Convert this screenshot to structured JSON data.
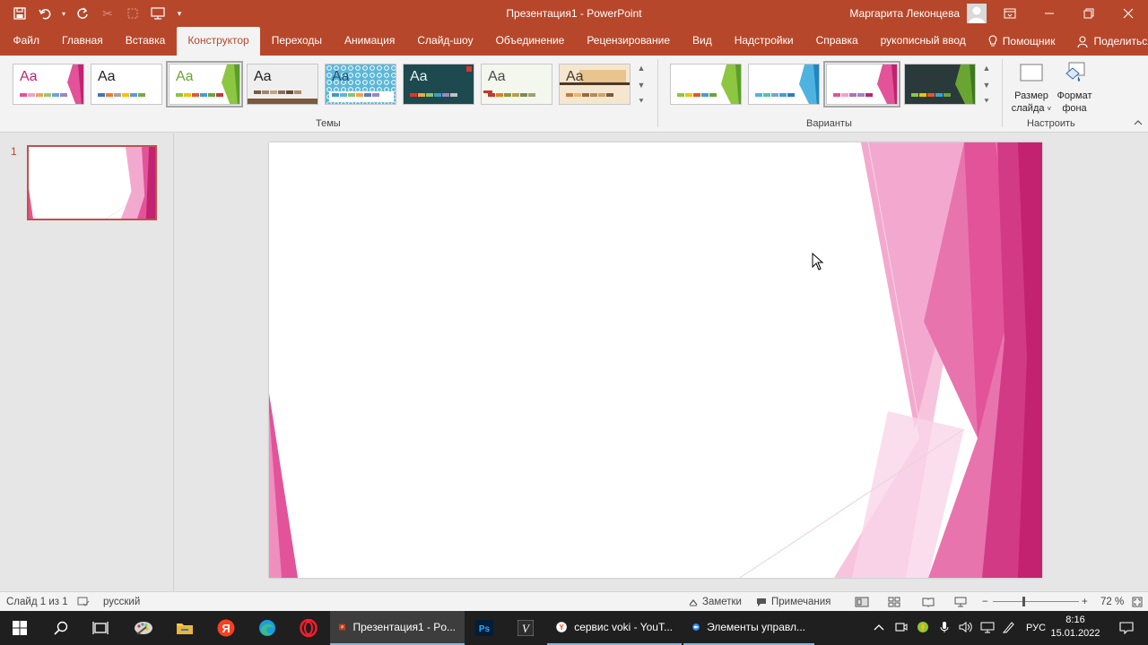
{
  "window": {
    "title": "Презентация1  -  PowerPoint",
    "user_name": "Маргарита Леконцева"
  },
  "tabs": [
    {
      "label": "Файл"
    },
    {
      "label": "Главная"
    },
    {
      "label": "Вставка"
    },
    {
      "label": "Конструктор",
      "active": true
    },
    {
      "label": "Переходы"
    },
    {
      "label": "Анимация"
    },
    {
      "label": "Слайд-шоу"
    },
    {
      "label": "Объединение"
    },
    {
      "label": "Рецензирование"
    },
    {
      "label": "Вид"
    },
    {
      "label": "Надстройки"
    },
    {
      "label": "Справка"
    },
    {
      "label": "рукописный ввод"
    },
    {
      "label": "Помощник"
    }
  ],
  "share_label": "Поделиться",
  "ribbon": {
    "themes_label": "Темы",
    "variants_label": "Варианты",
    "customize_label": "Настроить",
    "slide_size_label_1": "Размер",
    "slide_size_label_2": "слайда",
    "format_bg_label_1": "Формат",
    "format_bg_label_2": "фона",
    "theme_sample_text": "Aa"
  },
  "slides_pane": {
    "slide_number": "1"
  },
  "status": {
    "slide_info": "Слайд 1 из 1",
    "language": "русский",
    "notes_label": "Заметки",
    "comments_label": "Примечания",
    "zoom": "72 %"
  },
  "taskbar": {
    "apps": [
      {
        "label": "Презентация1 - Po..."
      },
      {
        "label": "сервис voki - YouT..."
      },
      {
        "label": "Элементы управл..."
      }
    ],
    "language": "РУС",
    "time": "8:16",
    "date": "15.01.2022"
  },
  "colors": {
    "accent": "#b7472a",
    "slide_pink": "#e2539a",
    "slide_magenta": "#c2226f"
  }
}
